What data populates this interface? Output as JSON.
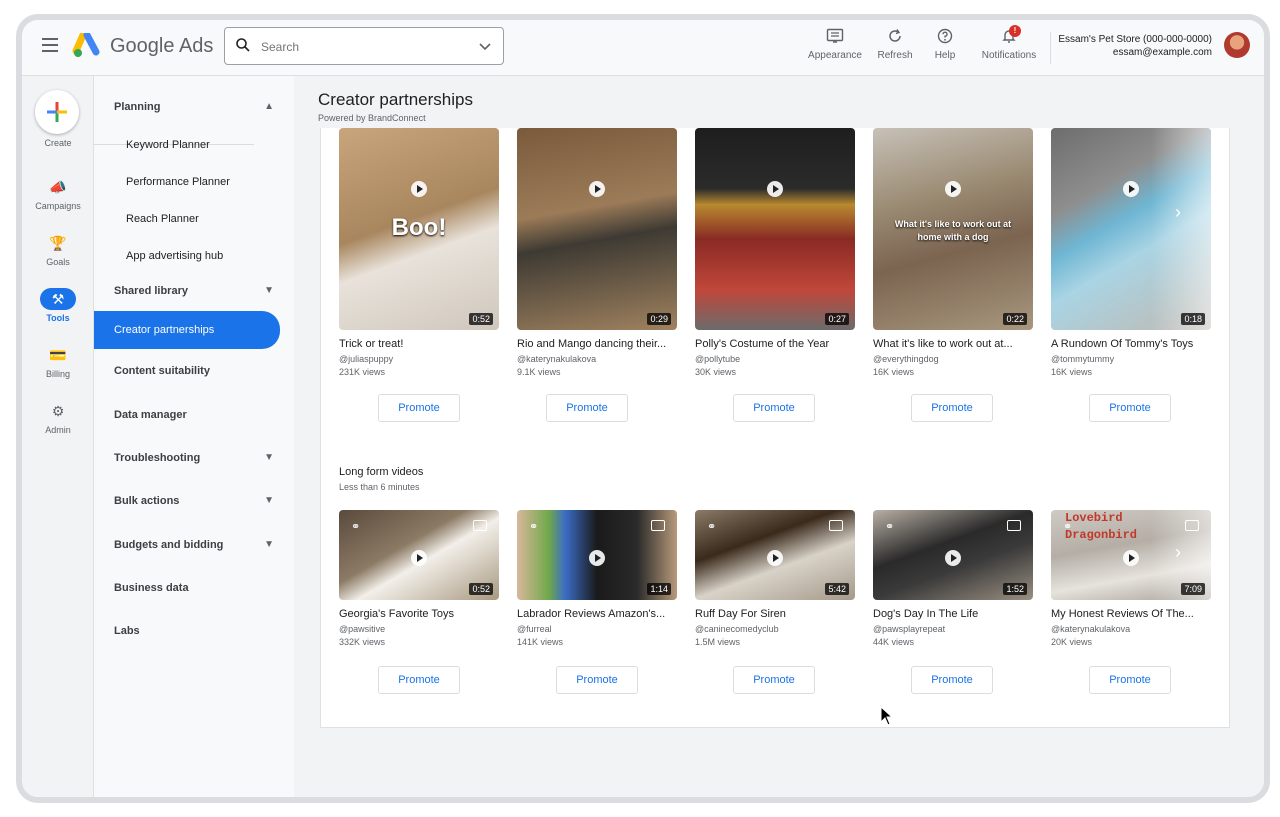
{
  "header": {
    "brand": "Google Ads",
    "search_placeholder": "Search",
    "actions": [
      {
        "label": "Appearance",
        "icon": "appearance-icon"
      },
      {
        "label": "Refresh",
        "icon": "refresh-icon"
      },
      {
        "label": "Help",
        "icon": "help-icon"
      },
      {
        "label": "Notifications",
        "icon": "bell-icon",
        "badge": "!"
      }
    ],
    "account_name": "Essam's Pet Store (000-000-0000)",
    "account_email": "essam@example.com"
  },
  "rail": [
    {
      "label": "Create",
      "icon": "plus-icon"
    },
    {
      "label": "Campaigns",
      "icon": "megaphone-icon"
    },
    {
      "label": "Goals",
      "icon": "trophy-icon"
    },
    {
      "label": "Tools",
      "icon": "tools-icon",
      "active": true
    },
    {
      "label": "Billing",
      "icon": "credit-card-icon"
    },
    {
      "label": "Admin",
      "icon": "gear-icon"
    }
  ],
  "sidenav": {
    "items": [
      {
        "label": "Planning"
      },
      {
        "label": "Keyword Planner"
      },
      {
        "label": "Performance Planner"
      },
      {
        "label": "Reach Planner"
      },
      {
        "label": "App advertising hub"
      },
      {
        "label": "Shared library"
      },
      {
        "label": "Creator partnerships"
      },
      {
        "label": "Content suitability"
      },
      {
        "label": "Data manager"
      },
      {
        "label": "Troubleshooting"
      },
      {
        "label": "Bulk actions"
      },
      {
        "label": "Budgets and bidding"
      },
      {
        "label": "Business data"
      },
      {
        "label": "Labs"
      }
    ]
  },
  "main": {
    "title": "Creator partnerships",
    "subtitle": "Powered by BrandConnect",
    "promote_label": "Promote",
    "short_videos": [
      {
        "title": "Trick or treat!",
        "handle": "@juliaspuppy",
        "views": "231K views",
        "duration": "0:52",
        "overlay": "Boo!"
      },
      {
        "title": "Rio and Mango dancing their...",
        "handle": "@katerynakulakova",
        "views": "9.1K views",
        "duration": "0:29",
        "overlay": ""
      },
      {
        "title": "Polly's Costume of the Year",
        "handle": "@pollytube",
        "views": "30K views",
        "duration": "0:27",
        "overlay": ""
      },
      {
        "title": "What it's like to work out at...",
        "handle": "@everythingdog",
        "views": "16K views",
        "duration": "0:22",
        "overlay": "What it's like to work out at home with a dog"
      },
      {
        "title": "A Rundown Of Tommy's Toys",
        "handle": "@tommytummy",
        "views": "16K views",
        "duration": "0:18",
        "overlay": ""
      }
    ],
    "long_section": {
      "title": "Long form videos",
      "subtitle": "Less than 6 minutes"
    },
    "long_videos": [
      {
        "title": "Georgia's Favorite Toys",
        "handle": "@pawsitive",
        "views": "332K views",
        "duration": "0:52",
        "overlay": ""
      },
      {
        "title": "Labrador Reviews Amazon's...",
        "handle": "@furreal",
        "views": "141K views",
        "duration": "1:14",
        "overlay": ""
      },
      {
        "title": "Ruff Day For Siren",
        "handle": "@caninecomedyclub",
        "views": "1.5M views",
        "duration": "5:42",
        "overlay": ""
      },
      {
        "title": "Dog's Day In The Life",
        "handle": "@pawsplayrepeat",
        "views": "44K views",
        "duration": "1:52",
        "overlay": ""
      },
      {
        "title": "My Honest Reviews Of The...",
        "handle": "@katerynakulakova",
        "views": "20K views",
        "duration": "7:09",
        "overlay": "Lovebird Dragonbird"
      }
    ]
  }
}
